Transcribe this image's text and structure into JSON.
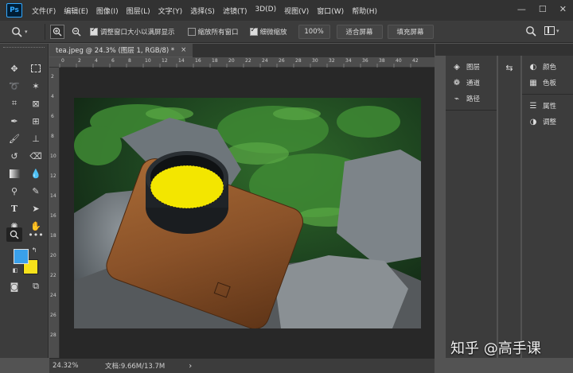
{
  "app": {
    "logo": "Ps"
  },
  "menu": [
    "文件(F)",
    "编辑(E)",
    "图像(I)",
    "图层(L)",
    "文字(Y)",
    "选择(S)",
    "滤镜(T)",
    "3D(D)",
    "视图(V)",
    "窗口(W)",
    "帮助(H)"
  ],
  "window_controls": {
    "minimize": "—",
    "maximize": "☐",
    "close": "✕"
  },
  "options": {
    "resize_windows_label": "调整窗口大小以满屏显示",
    "zoom_all_label": "缩放所有窗口",
    "scrubby_zoom_label": "细微缩放",
    "zoom_value": "100%",
    "fit_screen": "适合屏幕",
    "fill_screen": "填充屏幕"
  },
  "document": {
    "tab_title": "tea.jpeg @ 24.3% (图层 1, RGB/8) *",
    "tab_close": "×",
    "ruler_top": [
      "0",
      "2",
      "4",
      "6",
      "8",
      "10",
      "12",
      "14",
      "16",
      "18",
      "20",
      "22",
      "24",
      "26",
      "28",
      "30",
      "32",
      "34",
      "36",
      "38",
      "40",
      "42"
    ],
    "ruler_left": [
      "2",
      "4",
      "6",
      "8",
      "10",
      "12",
      "14",
      "16",
      "18",
      "20",
      "22",
      "24",
      "26",
      "28"
    ]
  },
  "status": {
    "zoom": "24.32%",
    "doc_info": "文档:9.66M/13.7M",
    "arrow": "›"
  },
  "panels_left": [
    {
      "icon": "layers-icon",
      "label": "图层"
    },
    {
      "icon": "channels-icon",
      "label": "通道"
    },
    {
      "icon": "paths-icon",
      "label": "路径"
    }
  ],
  "panels_right": [
    {
      "icon": "color-icon",
      "label": "颜色"
    },
    {
      "icon": "swatches-icon",
      "label": "色板"
    },
    {
      "icon": "properties-icon",
      "label": "属性"
    },
    {
      "icon": "adjustments-icon",
      "label": "调整"
    }
  ],
  "colors": {
    "foreground": "#3aa0ea",
    "background": "#f7e21b",
    "selection": "#f3e600"
  },
  "watermark": "知乎 @高手课"
}
